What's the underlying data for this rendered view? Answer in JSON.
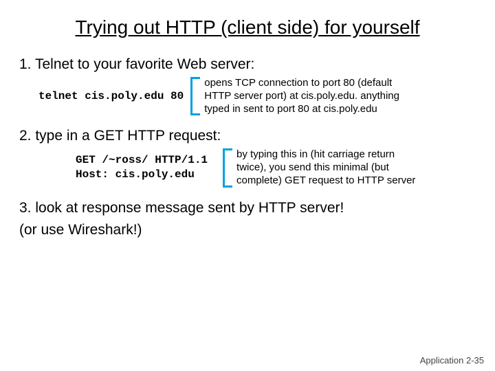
{
  "title": "Trying out HTTP (client side) for yourself",
  "step1": "1. Telnet to your favorite Web server:",
  "cmd1": "telnet cis.poly.edu 80",
  "note1": "opens TCP connection to port 80 (default HTTP server port) at cis.poly.edu. anything typed in sent to port 80 at cis.poly.edu",
  "step2": "2. type in a GET HTTP request:",
  "cmd2": "GET /~ross/ HTTP/1.1\nHost: cis.poly.edu",
  "note2": "by typing this in (hit carriage return twice), you send this minimal (but complete) GET request to HTTP server",
  "step3": "3. look at response message sent by HTTP server!",
  "step4": "(or use Wireshark!)",
  "footer": "Application 2-35"
}
